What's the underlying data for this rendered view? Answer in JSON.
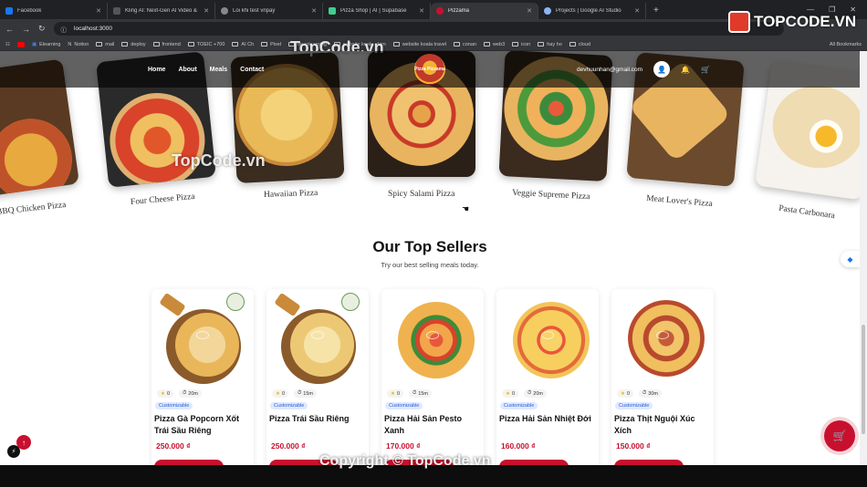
{
  "browser": {
    "tabs": [
      {
        "title": "Facebook",
        "color": "#1877f2"
      },
      {
        "title": "Kling AI: Next-Gen AI Video & I",
        "color": "#444"
      },
      {
        "title": "Lỗi khi test vnpay",
        "color": "#888"
      },
      {
        "title": "Pizza Shop | AI | Supabase",
        "color": "#3ecf8e"
      },
      {
        "title": "Pizzama",
        "color": "#c8102e"
      },
      {
        "title": "Projects | Google AI Studio",
        "color": "#8ab4f8"
      }
    ],
    "new_tab": "+",
    "url": "localhost:3000",
    "bookmarks": [
      "Elearning",
      "Notion",
      "mail",
      "deploy",
      "frontend",
      "TOEIC +700",
      "AI Ch",
      "Pixel",
      "deeplearning",
      "website koala phim",
      "website koala travel",
      "conan",
      "web3",
      "icon",
      "hay ho",
      "cloud"
    ],
    "all_bookmarks": "All Bookmarks"
  },
  "nav": {
    "links": [
      "Home",
      "About",
      "Meals",
      "Contact"
    ],
    "logo_text": "Pizza Pizzama",
    "email": "devhuunhan@gmail.com",
    "user_icon": "user-icon",
    "bell_icon": "bell-icon",
    "cart_icon": "cart-icon"
  },
  "carousel": [
    {
      "name": "BBQ Chicken Pizza"
    },
    {
      "name": "Four Cheese Pizza"
    },
    {
      "name": "Hawaiian Pizza"
    },
    {
      "name": "Spicy Salami Pizza"
    },
    {
      "name": "Veggie Supreme Pizza"
    },
    {
      "name": "Meat Lover's Pizza"
    },
    {
      "name": "Pasta Carbonara"
    }
  ],
  "top_sellers": {
    "title": "Our Top Sellers",
    "subtitle": "Try our best selling meals today.",
    "items": [
      {
        "rating": "0",
        "time": "20m",
        "badge": "Customizable",
        "name": "Pizza Gà Popcorn Xốt Trái Sầu Riêng",
        "price": "250.000 ₫"
      },
      {
        "rating": "0",
        "time": "15m",
        "badge": "Customizable",
        "name": "Pizza Trái Sầu Riêng",
        "price": "250.000 ₫"
      },
      {
        "rating": "0",
        "time": "15m",
        "badge": "Customizable",
        "name": "Pizza Hải Sản Pesto Xanh",
        "price": "170.000 ₫"
      },
      {
        "rating": "0",
        "time": "20m",
        "badge": "Customizable",
        "name": "Pizza Hải Sản Nhiệt Đới",
        "price": "160.000 ₫"
      },
      {
        "rating": "0",
        "time": "30m",
        "badge": "Customizable",
        "name": "Pizza Thịt Nguội Xúc Xích",
        "price": "150.000 ₫"
      }
    ]
  },
  "watermarks": {
    "top": "TopCode.vn",
    "middle": "TopCode.vn",
    "brand": "TOPCODE.VN",
    "copyright": "Copyright © TopCode.vn"
  },
  "colors": {
    "accent": "#c8102e",
    "badge_bg": "#dfe9ff",
    "badge_text": "#2a5bd7"
  }
}
